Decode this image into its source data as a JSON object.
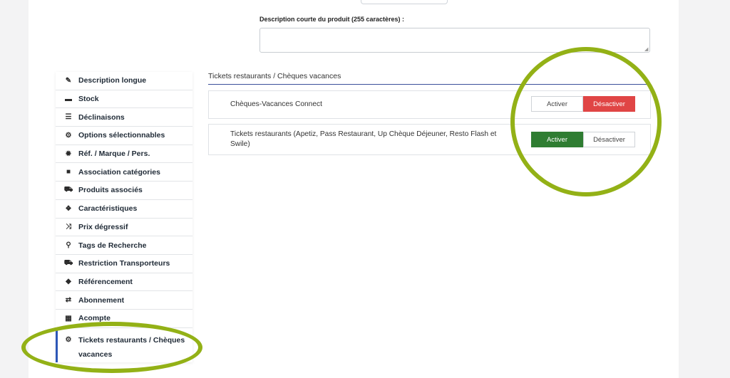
{
  "product": {
    "short_description_label": "Description courte du produit (255 caractères) :",
    "short_description_value": ""
  },
  "sidebar": {
    "items": [
      {
        "label": "Description longue",
        "icon": "edit-icon",
        "glyph": "✎"
      },
      {
        "label": "Stock",
        "icon": "box-icon",
        "glyph": "▬"
      },
      {
        "label": "Déclinaisons",
        "icon": "sliders-icon",
        "glyph": "☰"
      },
      {
        "label": "Options sélectionnables",
        "icon": "gears-icon",
        "glyph": "⚙"
      },
      {
        "label": "Réf. / Marque / Pers.",
        "icon": "certificate-icon",
        "glyph": "✹"
      },
      {
        "label": "Association catégories",
        "icon": "folder-icon",
        "glyph": "■"
      },
      {
        "label": "Produits associés",
        "icon": "cart-icon",
        "glyph": "⛟"
      },
      {
        "label": "Caractéristiques",
        "icon": "cubes-icon",
        "glyph": "❖"
      },
      {
        "label": "Prix dégressif",
        "icon": "random-icon",
        "glyph": "⤨"
      },
      {
        "label": "Tags de Recherche",
        "icon": "search-icon",
        "glyph": "⚲"
      },
      {
        "label": "Restriction Transporteurs",
        "icon": "truck-icon",
        "glyph": "⛟"
      },
      {
        "label": "Référencement",
        "icon": "tags-icon",
        "glyph": "◆"
      },
      {
        "label": "Abonnement",
        "icon": "retweet-icon",
        "glyph": "⇄"
      },
      {
        "label": "Acompte",
        "icon": "calculator-icon",
        "glyph": "▦"
      },
      {
        "label": "Tickets restaurants / Chèques vacances",
        "icon": "gears-icon",
        "glyph": "⚙"
      }
    ]
  },
  "section": {
    "title": "Tickets restaurants / Chèques vacances",
    "options": [
      {
        "label": "Chèques-Vacances Connect",
        "activate": "Activer",
        "deactivate": "Désactiver",
        "state": "inactive"
      },
      {
        "label": "Tickets restaurants (Apetiz, Pass Restaurant, Up Chèque Déjeuner, Resto Flash et Swile)",
        "activate": "Activer",
        "deactivate": "Désactiver",
        "state": "active"
      }
    ]
  },
  "colors": {
    "active_tab_border": "#2d57b7",
    "deactivate_red": "#e04545",
    "activate_green": "#2f7d32",
    "highlight_circle": "#93b116"
  }
}
